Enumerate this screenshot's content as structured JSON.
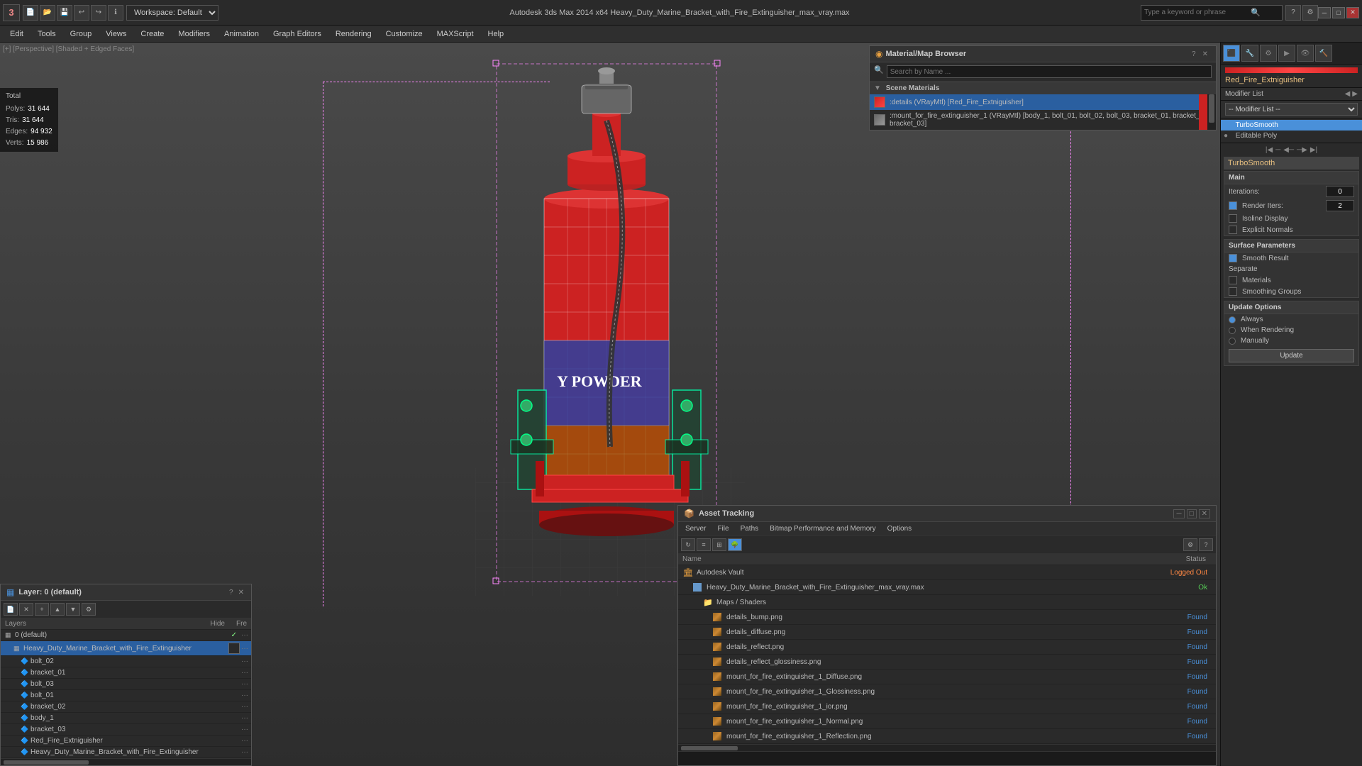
{
  "app": {
    "title": "Autodesk 3ds Max 2014 x64     Heavy_Duty_Marine_Bracket_with_Fire_Extinguisher_max_vray.max",
    "workspace_label": "Workspace: Default",
    "search_placeholder": "Type a keyword or phrase"
  },
  "menu": {
    "items": [
      "Edit",
      "Tools",
      "Group",
      "Views",
      "Create",
      "Modifiers",
      "Animation",
      "Graph Editors",
      "Rendering",
      "Customize",
      "MAXScript",
      "Help"
    ]
  },
  "viewport": {
    "label": "[+] [Perspective] [Shaded + Edged Faces]",
    "stats": {
      "polys_label": "Polys:",
      "polys_value": "31 644",
      "tris_label": "Tris:",
      "tris_value": "31 644",
      "edges_label": "Edges:",
      "edges_value": "94 932",
      "verts_label": "Verts:",
      "verts_value": "15 986"
    }
  },
  "material_browser": {
    "title": "Material/Map Browser",
    "search_placeholder": "Search by Name ...",
    "section_label": "Scene Materials",
    "items": [
      {
        "name": ":details (VRayMtl) [Red_Fire_Extniguisher]",
        "type": "vray"
      },
      {
        "name": ":mount_for_fire_extinguisher_1 (VRayMtl) [body_1, bolt_01, bolt_02, bolt_03, bracket_01, bracket_02, bracket_03]",
        "type": "vray"
      }
    ]
  },
  "right_panel": {
    "modifier_name": "Red_Fire_Extniguisher",
    "modifier_list_label": "Modifier List",
    "modifiers": [
      "TurboSmooth",
      "Editable Poly"
    ],
    "turbosmooth": {
      "main_label": "Main",
      "iterations_label": "Iterations:",
      "iterations_value": "0",
      "render_iters_label": "Render Iters:",
      "render_iters_value": "2",
      "isoline_label": "Isoline Display",
      "explicit_normals_label": "Explicit Normals",
      "surface_params_label": "Surface Parameters",
      "smooth_result_label": "Smooth Result",
      "separate_label": "Separate",
      "materials_label": "Materials",
      "smoothing_groups_label": "Smoothing Groups",
      "update_options_label": "Update Options",
      "always_label": "Always",
      "when_rendering_label": "When Rendering",
      "manually_label": "Manually",
      "update_btn_label": "Update"
    }
  },
  "layers": {
    "title": "Layer: 0 (default)",
    "columns": {
      "name": "Layers",
      "hide": "Hide",
      "freeze": "Fre"
    },
    "items": [
      {
        "name": "0 (default)",
        "level": 0,
        "checked": true
      },
      {
        "name": "Heavy_Duty_Marine_Bracket_with_Fire_Extinguisher",
        "level": 1,
        "selected": true
      },
      {
        "name": "bolt_02",
        "level": 2
      },
      {
        "name": "bracket_01",
        "level": 2
      },
      {
        "name": "bolt_03",
        "level": 2
      },
      {
        "name": "bolt_01",
        "level": 2
      },
      {
        "name": "bracket_02",
        "level": 2
      },
      {
        "name": "body_1",
        "level": 2
      },
      {
        "name": "bracket_03",
        "level": 2
      },
      {
        "name": "Red_Fire_Extniguisher",
        "level": 2
      },
      {
        "name": "Heavy_Duty_Marine_Bracket_with_Fire_Extinguisher",
        "level": 2
      }
    ]
  },
  "asset_tracking": {
    "title": "Asset Tracking",
    "menus": [
      "Server",
      "File",
      "Paths",
      "Bitmap Performance and Memory",
      "Options"
    ],
    "columns": {
      "name": "Name",
      "status": "Status"
    },
    "items": [
      {
        "name": "Autodesk Vault",
        "type": "vault",
        "indent": 0,
        "status": "Logged Out",
        "status_type": "loggedout"
      },
      {
        "name": "Heavy_Duty_Marine_Bracket_with_Fire_Extinguisher_max_vray.max",
        "type": "file",
        "indent": 1,
        "status": "Ok",
        "status_type": "ok"
      },
      {
        "name": "Maps / Shaders",
        "type": "folder",
        "indent": 2,
        "status": "",
        "status_type": ""
      },
      {
        "name": "details_bump.png",
        "type": "img",
        "indent": 3,
        "status": "Found",
        "status_type": "found"
      },
      {
        "name": "details_diffuse.png",
        "type": "img",
        "indent": 3,
        "status": "Found",
        "status_type": "found"
      },
      {
        "name": "details_reflect.png",
        "type": "img",
        "indent": 3,
        "status": "Found",
        "status_type": "found"
      },
      {
        "name": "details_reflect_glossiness.png",
        "type": "img",
        "indent": 3,
        "status": "Found",
        "status_type": "found"
      },
      {
        "name": "mount_for_fire_extinguisher_1_Diffuse.png",
        "type": "img",
        "indent": 3,
        "status": "Found",
        "status_type": "found"
      },
      {
        "name": "mount_for_fire_extinguisher_1_Glossiness.png",
        "type": "img",
        "indent": 3,
        "status": "Found",
        "status_type": "found"
      },
      {
        "name": "mount_for_fire_extinguisher_1_ior.png",
        "type": "img",
        "indent": 3,
        "status": "Found",
        "status_type": "found"
      },
      {
        "name": "mount_for_fire_extinguisher_1_Normal.png",
        "type": "img",
        "indent": 3,
        "status": "Found",
        "status_type": "found"
      },
      {
        "name": "mount_for_fire_extinguisher_1_Reflection.png",
        "type": "img",
        "indent": 3,
        "status": "Found",
        "status_type": "found"
      }
    ]
  }
}
